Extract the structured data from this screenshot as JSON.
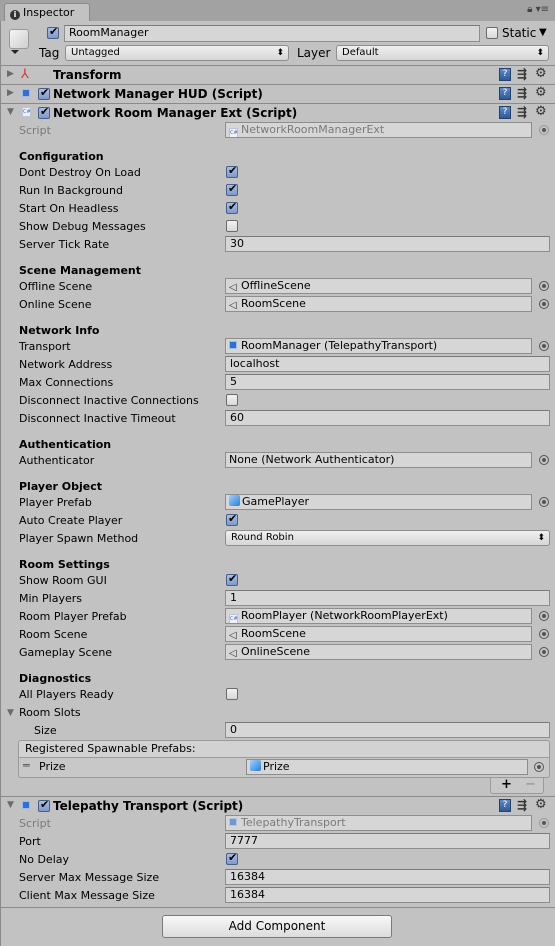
{
  "window": {
    "tab_label": "Inspector",
    "lock_icon": "lock-icon",
    "menu_icon": "menu-icon"
  },
  "gameobject": {
    "active": true,
    "name": "RoomManager",
    "static_label": "Static",
    "static": false,
    "tag_label": "Tag",
    "tag_value": "Untagged",
    "layer_label": "Layer",
    "layer_value": "Default"
  },
  "components": {
    "transform": {
      "title": "Transform",
      "expanded": false
    },
    "hud": {
      "title": "Network Manager HUD (Script)",
      "enabled": true,
      "expanded": false
    },
    "room_manager": {
      "title": "Network Room Manager Ext (Script)",
      "enabled": true,
      "expanded": true,
      "script_label": "Script",
      "script_value": "NetworkRoomManagerExt",
      "sections": {
        "configuration": "Configuration",
        "scene_management": "Scene Management",
        "network_info": "Network Info",
        "authentication": "Authentication",
        "player_object": "Player Object",
        "room_settings": "Room Settings",
        "diagnostics": "Diagnostics"
      },
      "fields": {
        "dont_destroy": {
          "label": "Dont Destroy On Load",
          "value": true
        },
        "run_bg": {
          "label": "Run In Background",
          "value": true
        },
        "start_headless": {
          "label": "Start On Headless",
          "value": true
        },
        "show_debug": {
          "label": "Show Debug Messages",
          "value": false
        },
        "tick_rate": {
          "label": "Server Tick Rate",
          "value": "30"
        },
        "offline_scene": {
          "label": "Offline Scene",
          "value": "OfflineScene"
        },
        "online_scene": {
          "label": "Online Scene",
          "value": "RoomScene"
        },
        "transport": {
          "label": "Transport",
          "value": "RoomManager (TelepathyTransport)"
        },
        "net_address": {
          "label": "Network Address",
          "value": "localhost"
        },
        "max_conn": {
          "label": "Max Connections",
          "value": "5"
        },
        "disc_inactive": {
          "label": "Disconnect Inactive Connections",
          "value": false
        },
        "disc_timeout": {
          "label": "Disconnect Inactive Timeout",
          "value": "60"
        },
        "authenticator": {
          "label": "Authenticator",
          "value": "None (Network Authenticator)"
        },
        "player_prefab": {
          "label": "Player Prefab",
          "value": "GamePlayer"
        },
        "auto_create": {
          "label": "Auto Create Player",
          "value": true
        },
        "spawn_method": {
          "label": "Player Spawn Method",
          "value": "Round Robin"
        },
        "show_room_gui": {
          "label": "Show Room GUI",
          "value": true
        },
        "min_players": {
          "label": "Min Players",
          "value": "1"
        },
        "room_player_prefab": {
          "label": "Room Player Prefab",
          "value": "RoomPlayer (NetworkRoomPlayerExt)"
        },
        "room_scene": {
          "label": "Room Scene",
          "value": "RoomScene"
        },
        "gameplay_scene": {
          "label": "Gameplay Scene",
          "value": "OnlineScene"
        },
        "all_ready": {
          "label": "All Players Ready",
          "value": false
        },
        "room_slots": {
          "label": "Room Slots",
          "expanded": true
        },
        "size": {
          "label": "Size",
          "value": "0"
        }
      },
      "spawnables": {
        "header": "Registered Spawnable Prefabs:",
        "items": [
          {
            "label": "Prize",
            "value": "Prize"
          }
        ],
        "add_label": "+",
        "remove_label": "−"
      }
    },
    "telepathy": {
      "title": "Telepathy Transport (Script)",
      "enabled": true,
      "expanded": true,
      "script_label": "Script",
      "script_value": "TelepathyTransport",
      "fields": {
        "port": {
          "label": "Port",
          "value": "7777"
        },
        "no_delay": {
          "label": "No Delay",
          "value": true
        },
        "server_max": {
          "label": "Server Max Message Size",
          "value": "16384"
        },
        "client_max": {
          "label": "Client Max Message Size",
          "value": "16384"
        }
      }
    }
  },
  "add_component_label": "Add Component"
}
